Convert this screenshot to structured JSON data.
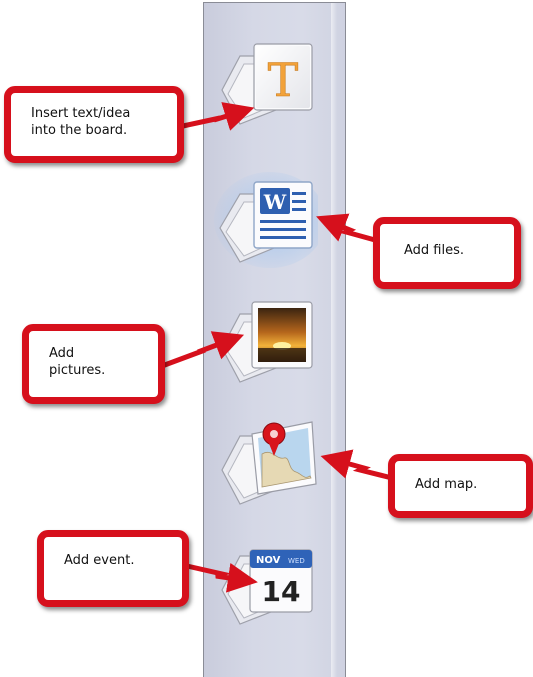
{
  "toolbar": {
    "buttons": [
      {
        "name": "insert-text",
        "icon": "text-T-icon",
        "glyph": "T"
      },
      {
        "name": "add-files",
        "icon": "word-document-icon",
        "glyph": "W"
      },
      {
        "name": "add-pictures",
        "icon": "sunset-picture-icon"
      },
      {
        "name": "add-map",
        "icon": "map-pin-icon"
      },
      {
        "name": "add-event",
        "icon": "calendar-icon",
        "month": "NOV",
        "weekday": "WED",
        "day": "14"
      }
    ]
  },
  "callouts": {
    "text": "Insert text/idea\ninto the board.",
    "files": "Add files.",
    "pictures": "Add\npictures.",
    "map": "Add map.",
    "event": "Add event."
  },
  "colors": {
    "callout_border": "#d6101c",
    "toolbar_bg": "#d5d8e6",
    "text_icon_letter": "#f2a23a",
    "word_blue": "#2e5fb0",
    "calendar_blue": "#2f63b8"
  }
}
